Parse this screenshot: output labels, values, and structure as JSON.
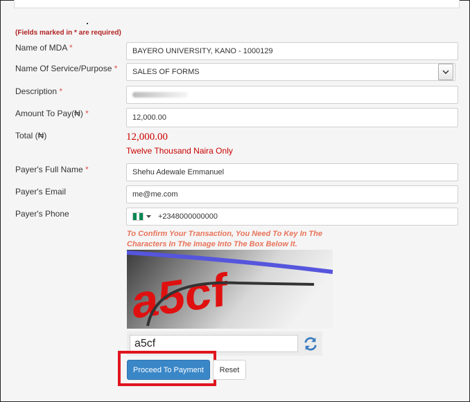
{
  "form": {
    "required_note": "(Fields marked in * are required)",
    "mda": {
      "label": "Name of MDA",
      "required": "*",
      "value": "BAYERO UNIVERSITY, KANO - 1000129"
    },
    "service": {
      "label": "Name Of Service/Purpose",
      "required": "*",
      "value": "SALES OF FORMS"
    },
    "description": {
      "label": "Description",
      "required": "*",
      "value": ""
    },
    "amount": {
      "label": "Amount To Pay(₦)",
      "required": "*",
      "value": "12,000.00"
    },
    "total": {
      "label": "Total (₦)",
      "value": "12,000.00",
      "words": "Twelve Thousand Naira Only"
    },
    "payer_name": {
      "label": "Payer's Full Name",
      "required": "*",
      "value": "Shehu Adewale Emmanuel"
    },
    "payer_email": {
      "label": "Payer's Email",
      "value": "me@me.com"
    },
    "payer_phone": {
      "label": "Payer's Phone",
      "value": "+2348000000000"
    }
  },
  "captcha": {
    "instructions": "To Confirm Your Transaction, You Need To Key In The Characters In The Image Into The Box Below It.",
    "image_text": "a5cf",
    "input_value": "a5cf"
  },
  "buttons": {
    "proceed": "Proceed To Payment",
    "reset": "Reset"
  },
  "colors": {
    "primary": "#3a87c8",
    "required": "#d9534f",
    "total": "#cc0000",
    "highlight": "#e0141e",
    "flag_green": "#008751"
  },
  "icons": {
    "service_dropdown": "chevron-down-icon",
    "phone_country": "nigeria-flag-icon",
    "captcha_refresh": "refresh-icon"
  }
}
